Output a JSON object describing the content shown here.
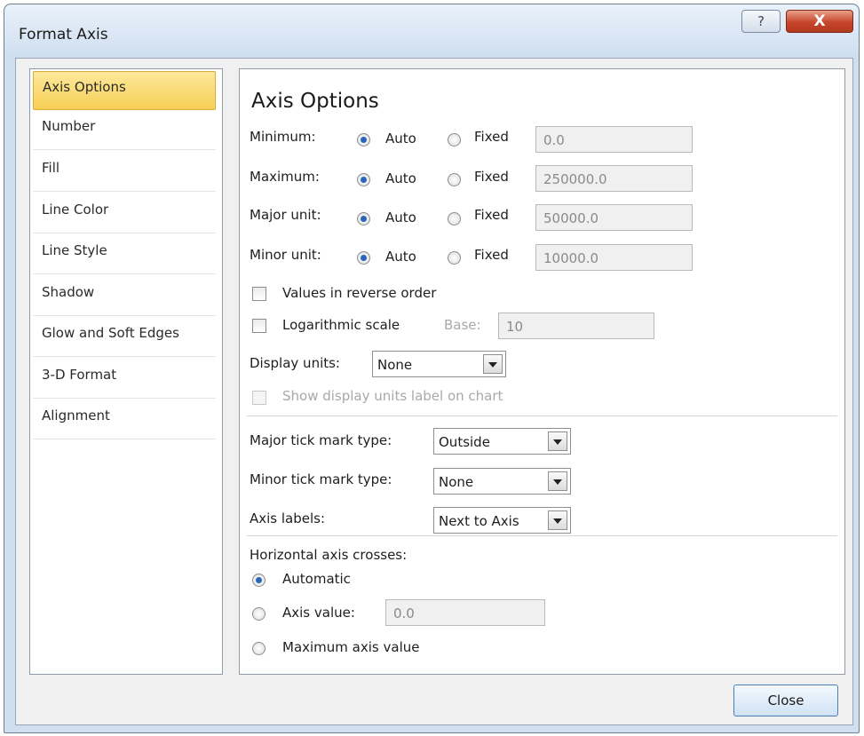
{
  "window": {
    "title": "Format Axis",
    "help_glyph": "?",
    "close_glyph": "X"
  },
  "nav": {
    "items": [
      {
        "label": "Axis Options",
        "selected": true
      },
      {
        "label": "Number"
      },
      {
        "label": "Fill"
      },
      {
        "label": "Line Color"
      },
      {
        "label": "Line Style"
      },
      {
        "label": "Shadow"
      },
      {
        "label": "Glow and Soft Edges"
      },
      {
        "label": "3-D Format"
      },
      {
        "label": "Alignment"
      }
    ]
  },
  "panel": {
    "heading": "Axis Options",
    "rows": [
      {
        "label": "Minimum:",
        "auto": "Auto",
        "fixed": "Fixed",
        "value": "0.0",
        "selected": "auto"
      },
      {
        "label": "Maximum:",
        "auto": "Auto",
        "fixed": "Fixed",
        "value": "250000.0",
        "selected": "auto"
      },
      {
        "label": "Major unit:",
        "auto": "Auto",
        "fixed": "Fixed",
        "value": "50000.0",
        "selected": "auto"
      },
      {
        "label": "Minor unit:",
        "auto": "Auto",
        "fixed": "Fixed",
        "value": "10000.0",
        "selected": "auto"
      }
    ],
    "reverse_order": {
      "label": "Values in reverse order",
      "checked": false
    },
    "log_scale": {
      "label": "Logarithmic scale",
      "base_label": "Base:",
      "base_value": "10",
      "checked": false
    },
    "display_units": {
      "label": "Display units:",
      "value": "None"
    },
    "show_units_label": {
      "label": "Show display units label on chart",
      "checked": false,
      "disabled": true
    },
    "major_tick": {
      "label": "Major tick mark type:",
      "value": "Outside"
    },
    "minor_tick": {
      "label": "Minor tick mark type:",
      "value": "None"
    },
    "axis_labels": {
      "label": "Axis labels:",
      "value": "Next to Axis"
    },
    "crosses": {
      "label": "Horizontal axis crosses:",
      "automatic": "Automatic",
      "axis_value": "Axis value:",
      "axis_value_input": "0.0",
      "maximum": "Maximum axis value",
      "selected": "automatic"
    }
  },
  "footer": {
    "close_label": "Close"
  },
  "colors": {
    "selected_nav": "#f7cf56",
    "radio_dot": "#2a66b8",
    "close_x": "#c8452a",
    "title_bar": "#cfdff0"
  }
}
